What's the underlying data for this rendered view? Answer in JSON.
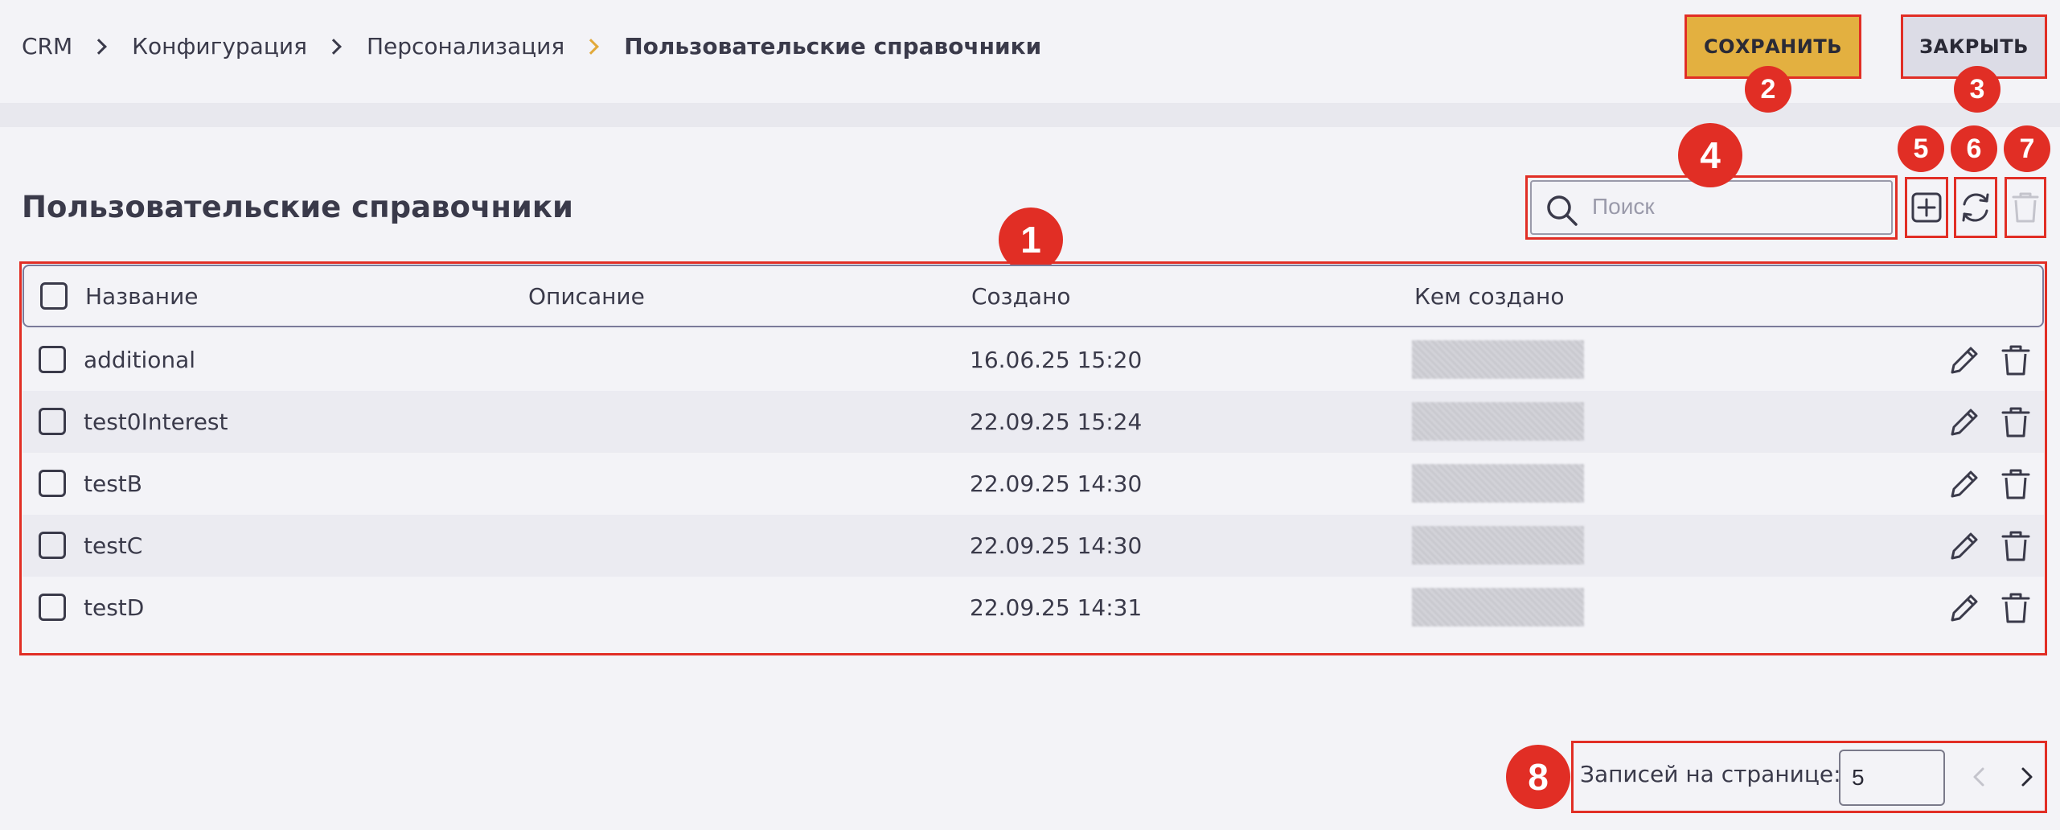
{
  "breadcrumb": {
    "items": [
      "CRM",
      "Конфигурация",
      "Персонализация",
      "Пользовательские справочники"
    ]
  },
  "header": {
    "save_label": "СОХРАНИТЬ",
    "close_label": "ЗАКРЫТЬ"
  },
  "page": {
    "title": "Пользовательские справочники"
  },
  "search": {
    "placeholder": "Поиск",
    "icon": "search-icon"
  },
  "toolbar": {
    "add_icon": "plus-square-icon",
    "refresh_icon": "refresh-icon",
    "delete_icon": "trash-icon-disabled"
  },
  "table": {
    "columns": [
      "Название",
      "Описание",
      "Создано",
      "Кем создано"
    ],
    "rows": [
      {
        "name": "additional",
        "description": "",
        "created": "16.06.25 15:20"
      },
      {
        "name": "test0Interest",
        "description": "",
        "created": "22.09.25 15:24"
      },
      {
        "name": "testB",
        "description": "",
        "created": "22.09.25 14:30"
      },
      {
        "name": "testC",
        "description": "",
        "created": "22.09.25 14:30"
      },
      {
        "name": "testD",
        "description": "",
        "created": "22.09.25 14:31"
      }
    ]
  },
  "pagination": {
    "label": "Записей на странице:",
    "page_size": "5"
  },
  "badges": [
    "1",
    "2",
    "3",
    "4",
    "5",
    "6",
    "7",
    "8"
  ],
  "colors": {
    "accent": "#e3b040",
    "annotation": "#e12e25",
    "background": "#f3f3f7",
    "text": "#3a3a4a"
  }
}
